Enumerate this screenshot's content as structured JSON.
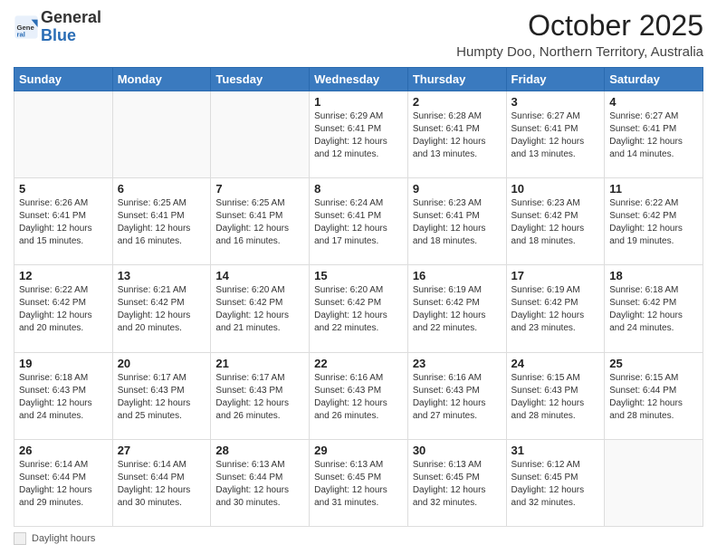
{
  "logo": {
    "general": "General",
    "blue": "Blue"
  },
  "header": {
    "month": "October 2025",
    "location": "Humpty Doo, Northern Territory, Australia"
  },
  "days_of_week": [
    "Sunday",
    "Monday",
    "Tuesday",
    "Wednesday",
    "Thursday",
    "Friday",
    "Saturday"
  ],
  "weeks": [
    [
      {
        "day": "",
        "info": ""
      },
      {
        "day": "",
        "info": ""
      },
      {
        "day": "",
        "info": ""
      },
      {
        "day": "1",
        "info": "Sunrise: 6:29 AM\nSunset: 6:41 PM\nDaylight: 12 hours and 12 minutes."
      },
      {
        "day": "2",
        "info": "Sunrise: 6:28 AM\nSunset: 6:41 PM\nDaylight: 12 hours and 13 minutes."
      },
      {
        "day": "3",
        "info": "Sunrise: 6:27 AM\nSunset: 6:41 PM\nDaylight: 12 hours and 13 minutes."
      },
      {
        "day": "4",
        "info": "Sunrise: 6:27 AM\nSunset: 6:41 PM\nDaylight: 12 hours and 14 minutes."
      }
    ],
    [
      {
        "day": "5",
        "info": "Sunrise: 6:26 AM\nSunset: 6:41 PM\nDaylight: 12 hours and 15 minutes."
      },
      {
        "day": "6",
        "info": "Sunrise: 6:25 AM\nSunset: 6:41 PM\nDaylight: 12 hours and 16 minutes."
      },
      {
        "day": "7",
        "info": "Sunrise: 6:25 AM\nSunset: 6:41 PM\nDaylight: 12 hours and 16 minutes."
      },
      {
        "day": "8",
        "info": "Sunrise: 6:24 AM\nSunset: 6:41 PM\nDaylight: 12 hours and 17 minutes."
      },
      {
        "day": "9",
        "info": "Sunrise: 6:23 AM\nSunset: 6:41 PM\nDaylight: 12 hours and 18 minutes."
      },
      {
        "day": "10",
        "info": "Sunrise: 6:23 AM\nSunset: 6:42 PM\nDaylight: 12 hours and 18 minutes."
      },
      {
        "day": "11",
        "info": "Sunrise: 6:22 AM\nSunset: 6:42 PM\nDaylight: 12 hours and 19 minutes."
      }
    ],
    [
      {
        "day": "12",
        "info": "Sunrise: 6:22 AM\nSunset: 6:42 PM\nDaylight: 12 hours and 20 minutes."
      },
      {
        "day": "13",
        "info": "Sunrise: 6:21 AM\nSunset: 6:42 PM\nDaylight: 12 hours and 20 minutes."
      },
      {
        "day": "14",
        "info": "Sunrise: 6:20 AM\nSunset: 6:42 PM\nDaylight: 12 hours and 21 minutes."
      },
      {
        "day": "15",
        "info": "Sunrise: 6:20 AM\nSunset: 6:42 PM\nDaylight: 12 hours and 22 minutes."
      },
      {
        "day": "16",
        "info": "Sunrise: 6:19 AM\nSunset: 6:42 PM\nDaylight: 12 hours and 22 minutes."
      },
      {
        "day": "17",
        "info": "Sunrise: 6:19 AM\nSunset: 6:42 PM\nDaylight: 12 hours and 23 minutes."
      },
      {
        "day": "18",
        "info": "Sunrise: 6:18 AM\nSunset: 6:42 PM\nDaylight: 12 hours and 24 minutes."
      }
    ],
    [
      {
        "day": "19",
        "info": "Sunrise: 6:18 AM\nSunset: 6:43 PM\nDaylight: 12 hours and 24 minutes."
      },
      {
        "day": "20",
        "info": "Sunrise: 6:17 AM\nSunset: 6:43 PM\nDaylight: 12 hours and 25 minutes."
      },
      {
        "day": "21",
        "info": "Sunrise: 6:17 AM\nSunset: 6:43 PM\nDaylight: 12 hours and 26 minutes."
      },
      {
        "day": "22",
        "info": "Sunrise: 6:16 AM\nSunset: 6:43 PM\nDaylight: 12 hours and 26 minutes."
      },
      {
        "day": "23",
        "info": "Sunrise: 6:16 AM\nSunset: 6:43 PM\nDaylight: 12 hours and 27 minutes."
      },
      {
        "day": "24",
        "info": "Sunrise: 6:15 AM\nSunset: 6:43 PM\nDaylight: 12 hours and 28 minutes."
      },
      {
        "day": "25",
        "info": "Sunrise: 6:15 AM\nSunset: 6:44 PM\nDaylight: 12 hours and 28 minutes."
      }
    ],
    [
      {
        "day": "26",
        "info": "Sunrise: 6:14 AM\nSunset: 6:44 PM\nDaylight: 12 hours and 29 minutes."
      },
      {
        "day": "27",
        "info": "Sunrise: 6:14 AM\nSunset: 6:44 PM\nDaylight: 12 hours and 30 minutes."
      },
      {
        "day": "28",
        "info": "Sunrise: 6:13 AM\nSunset: 6:44 PM\nDaylight: 12 hours and 30 minutes."
      },
      {
        "day": "29",
        "info": "Sunrise: 6:13 AM\nSunset: 6:45 PM\nDaylight: 12 hours and 31 minutes."
      },
      {
        "day": "30",
        "info": "Sunrise: 6:13 AM\nSunset: 6:45 PM\nDaylight: 12 hours and 32 minutes."
      },
      {
        "day": "31",
        "info": "Sunrise: 6:12 AM\nSunset: 6:45 PM\nDaylight: 12 hours and 32 minutes."
      },
      {
        "day": "",
        "info": ""
      }
    ]
  ],
  "footer": {
    "daylight_label": "Daylight hours"
  }
}
